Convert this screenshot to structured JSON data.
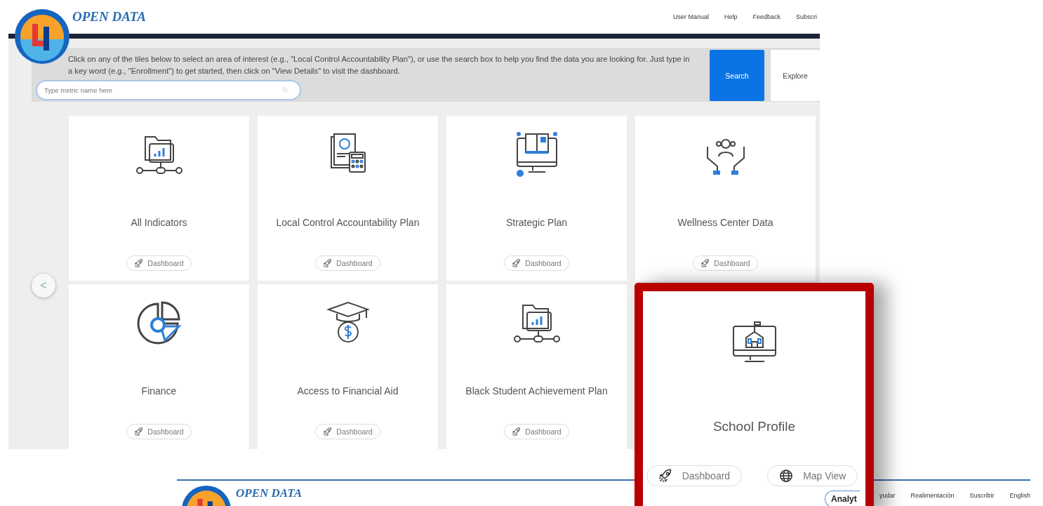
{
  "header": {
    "title": "OPEN DATA",
    "nav": [
      "User Manual",
      "Help",
      "Feedback",
      "Subscri"
    ]
  },
  "intro": {
    "text": "Click on any of the tiles below to select an area of interest (e.g., \"Local Control Accountability Plan\"), or use the search box to help you find the data you are looking for. Just type in a key word (e.g., \"Enrollment\") to get started, then click on \"View Details\" to visit the dashboard.",
    "search": {
      "placeholder": "Type metric name here"
    },
    "buttons": [
      {
        "label": "Search",
        "kind": "primary"
      },
      {
        "label": "Explore",
        "kind": "secondary"
      }
    ]
  },
  "carousel": {
    "prev": "<",
    "tiles": [
      {
        "title": "All Indicators",
        "kind": "folder",
        "action": "Dashboard"
      },
      {
        "title": "Local Control Accountability Plan",
        "kind": "report",
        "action": "Dashboard"
      },
      {
        "title": "Strategic Plan",
        "kind": "book",
        "action": "Dashboard"
      },
      {
        "title": "Wellness Center Data",
        "kind": "hands",
        "action": "Dashboard"
      },
      {
        "title": "Finance",
        "kind": "pie",
        "action": "Dashboard"
      },
      {
        "title": "Access to Financial Aid",
        "kind": "cap",
        "action": "Dashboard"
      },
      {
        "title": "Black Student Achievement Plan",
        "kind": "folder",
        "action": "Dashboard"
      }
    ]
  },
  "highlight": {
    "title": "School Profile",
    "actions": [
      {
        "label": "Dashboard",
        "kind": "rocket"
      },
      {
        "label": "Map View",
        "kind": "globe"
      }
    ],
    "overlap_button": "Analyt"
  },
  "second_page": {
    "title": "OPEN DATA",
    "nav": [
      "yudar",
      "Realimentación",
      "Suscribir",
      "English"
    ]
  }
}
